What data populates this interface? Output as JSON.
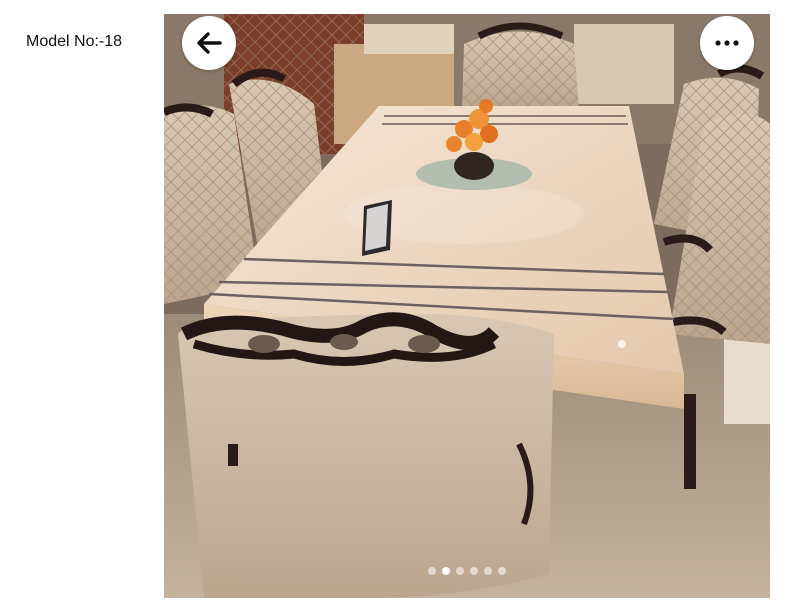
{
  "page": {
    "model_label": "Model No:-18"
  },
  "viewer": {
    "photo_subject": "dining-set-photo",
    "back_icon": "arrow-left-icon",
    "more_icon": "more-horizontal-icon",
    "pagination": {
      "count": 6,
      "active_index": 1
    }
  }
}
